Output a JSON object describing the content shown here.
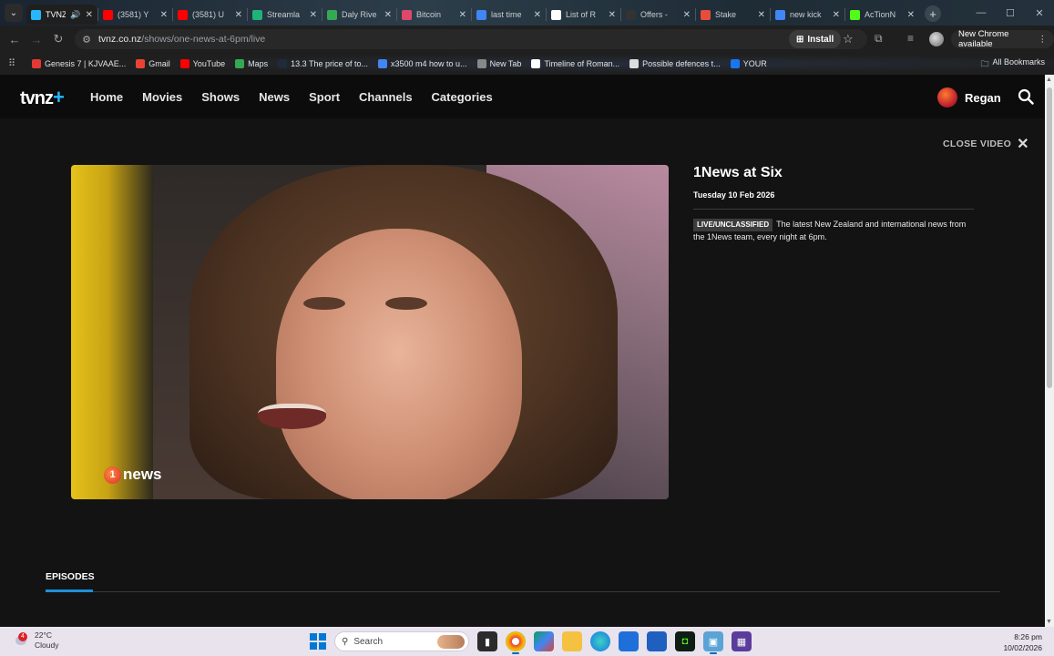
{
  "browser": {
    "tabs": [
      {
        "title": "TVNZ",
        "active": true,
        "favicon_color": "#27b7ff",
        "extra": "🔊"
      },
      {
        "title": "(3581) Y",
        "favicon_color": "#ff0000"
      },
      {
        "title": "(3581) U",
        "favicon_color": "#ff0000"
      },
      {
        "title": "Streamla",
        "favicon_color": "#1fb37a"
      },
      {
        "title": "Daly Rive",
        "favicon_color": "#34a853"
      },
      {
        "title": "Bitcoin",
        "favicon_color": "#e0486a"
      },
      {
        "title": "last time",
        "favicon_color": "#4285f4"
      },
      {
        "title": "List of R",
        "favicon_color": "#ffffff"
      },
      {
        "title": "Offers -",
        "favicon_color": "#333333"
      },
      {
        "title": "Stake",
        "favicon_color": "#e74c3c"
      },
      {
        "title": "new kick",
        "favicon_color": "#4285f4"
      },
      {
        "title": "AcTionN",
        "favicon_color": "#53fc18"
      }
    ],
    "new_tab": "+",
    "window_controls": {
      "minimize": "—",
      "maximize": "☐",
      "close": "✕"
    },
    "url_host": "tvnz.co.nz",
    "url_path": "/shows/one-news-at-6pm/live",
    "install_label": "Install",
    "new_chrome_label": "New Chrome available",
    "bookmarks": [
      {
        "label": "Genesis 7 | KJVAAE...",
        "color": "#e53935"
      },
      {
        "label": "Gmail",
        "color": "#ea4335"
      },
      {
        "label": "YouTube",
        "color": "#ff0000"
      },
      {
        "label": "Maps",
        "color": "#34a853"
      },
      {
        "label": "13.3 The price of to...",
        "color": "#1f2a3a"
      },
      {
        "label": "x3500 m4 how to u...",
        "color": "#4285f4"
      },
      {
        "label": "New Tab",
        "color": "#888888"
      },
      {
        "label": "Timeline of Roman...",
        "color": "#ffffff"
      },
      {
        "label": "Possible defences t...",
        "color": "#dddddd"
      },
      {
        "label": "YOUR",
        "color": "#1877f2"
      }
    ],
    "all_bookmarks_label": "All Bookmarks"
  },
  "site": {
    "logo": "tvnz",
    "logo_plus": "+",
    "nav": [
      "Home",
      "Movies",
      "Shows",
      "News",
      "Sport",
      "Channels",
      "Categories"
    ],
    "user_name": "Regan",
    "close_video_label": "CLOSE VIDEO",
    "video_channel_logo": "news",
    "video_channel_logo_num": "1",
    "show_title": "1News at Six",
    "show_date": "Tuesday 10 Feb 2026",
    "show_badge": "LIVE/UNCLASSIFIED",
    "show_description": "The latest New Zealand and international news from the 1News team, every night at 6pm.",
    "episodes_tab": "EPISODES"
  },
  "taskbar": {
    "weather_temp": "22°C",
    "weather_desc": "Cloudy",
    "weather_badge": "4",
    "search_label": "Search",
    "time": "8:26 pm",
    "date": "10/02/2026"
  }
}
